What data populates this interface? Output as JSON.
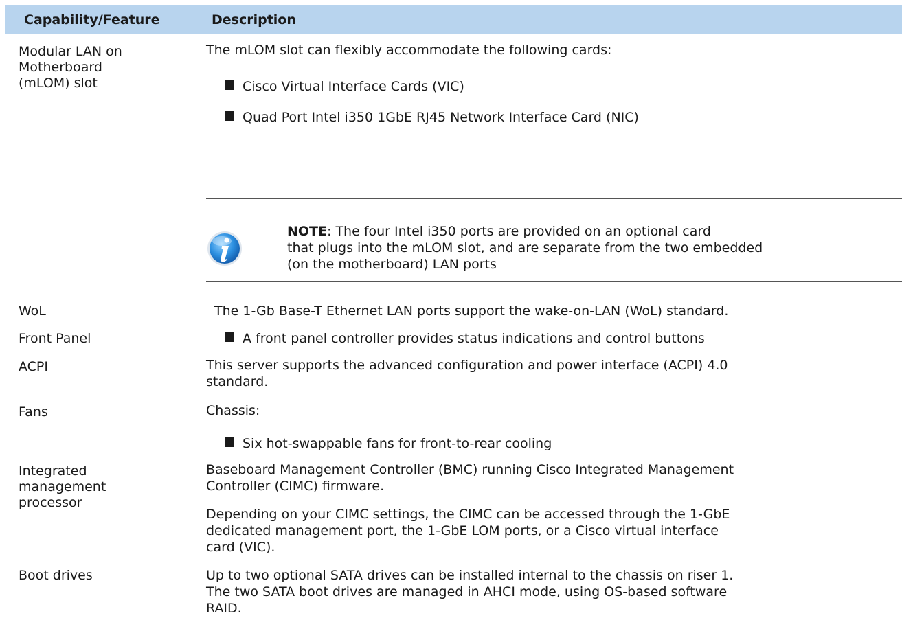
{
  "header": {
    "col1": "Capability/Feature",
    "col2": "Description"
  },
  "rows": {
    "mlom": {
      "feature": [
        "Modular LAN on",
        "Motherboard",
        "(mLOM) slot"
      ],
      "intro": "The mLOM slot can flexibly accommodate the following cards:",
      "bullets": [
        "Cisco Virtual Interface Cards (VIC)",
        "Quad Port Intel i350 1GbE RJ45 Network Interface Card (NIC)"
      ],
      "note": {
        "label": "NOTE",
        "lines": [
          ":  The four Intel i350 ports are provided on an optional card",
          "that plugs into the mLOM slot, and are separate from the two embedded",
          "(on the motherboard) LAN ports"
        ]
      }
    },
    "wol": {
      "feature": "WoL",
      "text": "The 1-Gb Base-T Ethernet LAN ports support the wake-on-LAN (WoL) standard."
    },
    "front_panel": {
      "feature": "Front Panel",
      "bullet": "A front panel controller provides status indications and control buttons"
    },
    "acpi": {
      "feature": "ACPI",
      "lines": [
        "This server supports the advanced configuration and power interface (ACPI) 4.0",
        "standard."
      ]
    },
    "fans": {
      "feature": "Fans",
      "text": "Chassis:",
      "bullet": "Six hot-swappable fans for front-to-rear cooling"
    },
    "imp": {
      "feature": [
        "Integrated",
        "management",
        "processor"
      ],
      "para1": [
        "Baseboard Management Controller (BMC) running Cisco Integrated Management",
        "Controller (CIMC) firmware."
      ],
      "para2": [
        "Depending on your CIMC settings, the CIMC can be accessed through the 1-GbE",
        "dedicated management port, the 1-GbE LOM ports, or a Cisco virtual interface",
        "card (VIC)."
      ]
    },
    "boot": {
      "feature": "Boot drives",
      "lines": [
        "Up to two optional SATA drives can be installed internal to the chassis on riser 1.",
        "The two SATA boot drives are managed in AHCI mode, using OS-based software",
        "RAID."
      ]
    }
  },
  "icons": {
    "note_icon": "info-icon"
  }
}
